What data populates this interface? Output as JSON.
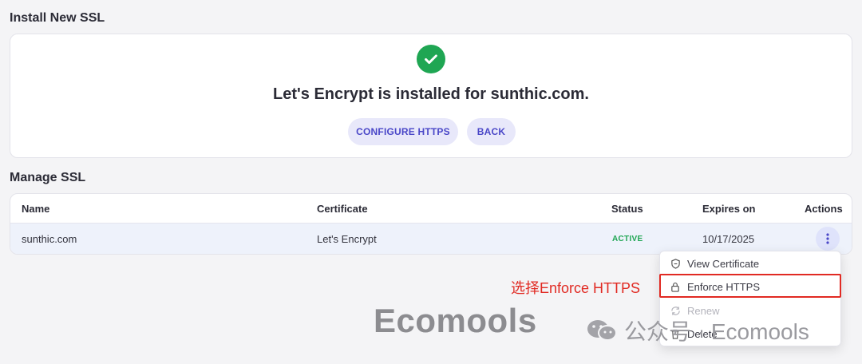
{
  "install_section": {
    "title": "Install New SSL",
    "message": "Let's Encrypt is installed for sunthic.com.",
    "configure_label": "CONFIGURE HTTPS",
    "back_label": "BACK"
  },
  "manage_section": {
    "title": "Manage SSL",
    "headers": {
      "name": "Name",
      "certificate": "Certificate",
      "status": "Status",
      "expires": "Expires on",
      "actions": "Actions"
    },
    "rows": [
      {
        "name": "sunthic.com",
        "certificate": "Let's Encrypt",
        "status": "ACTIVE",
        "expires": "10/17/2025"
      }
    ]
  },
  "actions_menu": {
    "items": [
      {
        "label": "View Certificate",
        "icon": "certificate-icon"
      },
      {
        "label": "Enforce HTTPS",
        "icon": "lock-icon"
      },
      {
        "label": "Renew",
        "icon": "refresh-icon"
      },
      {
        "label": "Delete",
        "icon": "trash-icon"
      }
    ]
  },
  "annotation": {
    "text": "选择Enforce HTTPS"
  },
  "watermark": {
    "logo_text": "Ecomools",
    "account_text": "公众号 · Ecomools",
    "icon": "wechat-icon"
  },
  "colors": {
    "success": "#1fa653",
    "accent": "#4a47c8",
    "annotation": "#e12a23"
  }
}
